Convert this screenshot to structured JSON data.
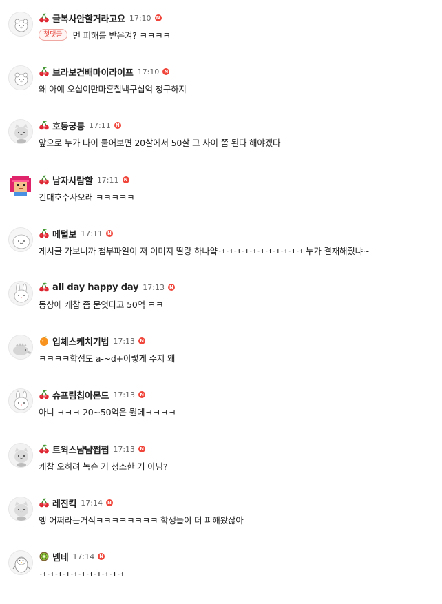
{
  "comments": [
    {
      "nick": "글복사안할거라고요",
      "time": "17:10",
      "new": "N",
      "tag": "첫댓글",
      "text": "먼 피해를 받은겨? ㅋㅋㅋㅋ",
      "level": "cherry",
      "avatar": "bear"
    },
    {
      "nick": "브라보건배마이라이프",
      "time": "17:10",
      "new": "N",
      "text": "왜 아예 오십이만마흔칠백구십억 청구하지",
      "level": "cherry",
      "avatar": "bear"
    },
    {
      "nick": "호둥궁릉",
      "time": "17:11",
      "new": "N",
      "text": "앞으로 누가 나이 물어보면 20살에서 50살 그 사이 쯤 된다 해야겠다",
      "level": "cherry",
      "avatar": "cat"
    },
    {
      "nick": "남자사람할",
      "time": "17:11",
      "new": "N",
      "text": "건대호수사오래 ㅋㅋㅋㅋㅋ",
      "level": "cherry",
      "avatar": "pixel"
    },
    {
      "nick": "메털보",
      "time": "17:11",
      "new": "N",
      "text": "게시글 가보니까 첨부파일이 저 이미지 딸랑 하나얔ㅋㅋㅋㅋㅋㅋㅋㅋㅋㅋㅋ 누가 결재해줬냐~",
      "level": "cherry",
      "avatar": "blob"
    },
    {
      "nick": "all day happy day",
      "time": "17:13",
      "new": "N",
      "text": "동상에 케찹 좀 묻엇다고 50억 ㅋㅋ",
      "level": "cherry",
      "avatar": "rabbit"
    },
    {
      "nick": "입체스케치기법",
      "time": "17:13",
      "new": "N",
      "text": "ㅋㅋㅋㅋ학점도 a-~d+이렇게 주지 왜",
      "level": "orange",
      "avatar": "dino"
    },
    {
      "nick": "슈프림칩아몬드",
      "time": "17:13",
      "new": "N",
      "text": "아니 ㅋㅋㅋ 20~50억은 뭔데ㅋㅋㅋㅋ",
      "level": "cherry",
      "avatar": "rabbit"
    },
    {
      "nick": "트윅스냠냠쩝쩝",
      "time": "17:13",
      "new": "N",
      "text": "케찹 오히려 녹슨 거 청소한 거 아님?",
      "level": "cherry",
      "avatar": "cat"
    },
    {
      "nick": "레진킥",
      "time": "17:14",
      "new": "N",
      "text": "엥 어쩌라는거짘ㅋㅋㅋㅋㅋㅋㅋㅋ 학생들이 더 피해봤잖아",
      "level": "cherry",
      "avatar": "cat"
    },
    {
      "nick": "넴네",
      "time": "17:14",
      "new": "N",
      "text": "ㅋㅋㅋㅋㅋㅋㅋㅋㅋㅋㅋ",
      "level": "kiwi",
      "avatar": "penguin"
    }
  ]
}
